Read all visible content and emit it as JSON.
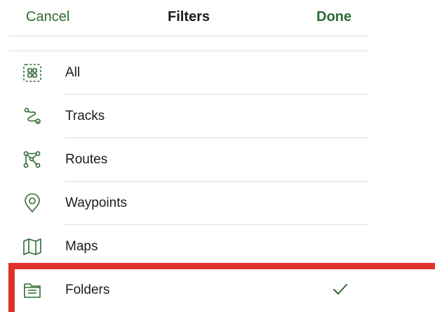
{
  "header": {
    "cancel_label": "Cancel",
    "title": "Filters",
    "done_label": "Done"
  },
  "filters": [
    {
      "label": "All",
      "icon": "grid-dashed-icon"
    },
    {
      "label": "Tracks",
      "icon": "track-path-icon"
    },
    {
      "label": "Routes",
      "icon": "route-nodes-icon"
    },
    {
      "label": "Waypoints",
      "icon": "map-pin-icon"
    },
    {
      "label": "Maps",
      "icon": "folded-map-icon"
    },
    {
      "label": "Folders",
      "icon": "folder-icon",
      "selected": true
    }
  ],
  "colors": {
    "accent": "#2e6b33",
    "icon": "#2e6b33",
    "highlight": "#e0312b",
    "divider": "#dcdcdc"
  }
}
